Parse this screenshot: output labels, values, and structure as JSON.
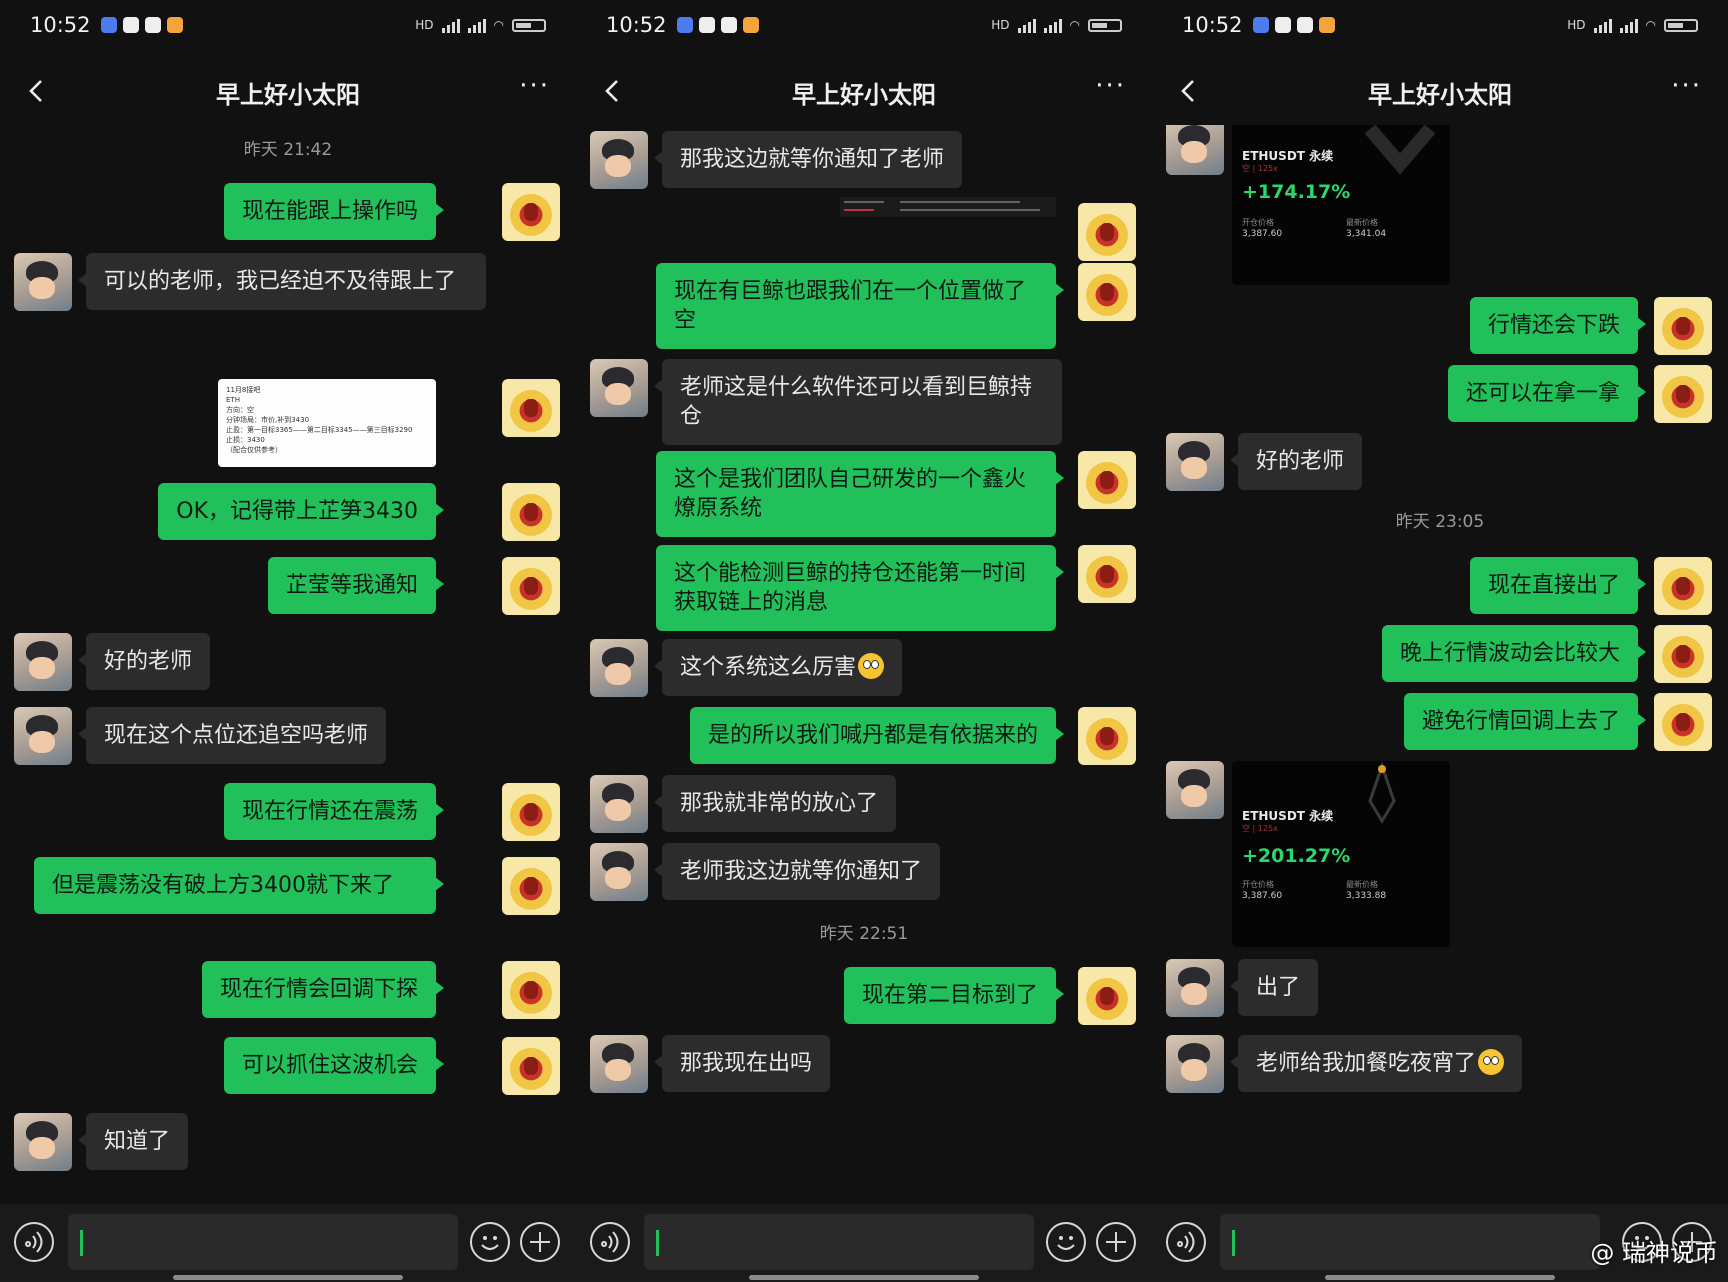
{
  "status_bar": {
    "time": "10:52",
    "network": "5G 4G",
    "hd": "HD"
  },
  "chat": {
    "title": "早上好小太阳"
  },
  "screens": [
    {
      "time_labels": [
        "昨天 21:42"
      ],
      "messages": [
        {
          "from": "me",
          "text": "现在能跟上操作吗"
        },
        {
          "from": "other",
          "text": "可以的老师，我已经迫不及待跟上了"
        },
        {
          "from": "me",
          "type": "image",
          "image_text": [
            "11月8接吧",
            "ETH",
            "方向：空",
            "分钟场局：市价,补到3430",
            "止盈：第一目标3365——第二目标3345——第三目标3290",
            "止损：3430",
            "（配合仅供参考）"
          ]
        },
        {
          "from": "me",
          "text": "OK，记得带上芷笋3430"
        },
        {
          "from": "me",
          "text": "芷莹等我通知"
        },
        {
          "from": "other",
          "text": "好的老师"
        },
        {
          "from": "other",
          "text": "现在这个点位还追空吗老师"
        },
        {
          "from": "me",
          "text": "现在行情还在震荡"
        },
        {
          "from": "me",
          "text": "但是震荡没有破上方3400就下来了"
        },
        {
          "from": "me",
          "text": "现在行情会回调下探"
        },
        {
          "from": "me",
          "text": "可以抓住这波机会"
        },
        {
          "from": "other",
          "text": "知道了"
        }
      ]
    },
    {
      "time_labels": [
        "昨天 22:51"
      ],
      "messages": [
        {
          "from": "other",
          "text": "那我这边就等你通知了老师"
        },
        {
          "from": "me",
          "type": "image",
          "image_text": []
        },
        {
          "from": "me",
          "text": "现在有巨鲸也跟我们在一个位置做了空"
        },
        {
          "from": "other",
          "text": "老师这是什么软件还可以看到巨鲸持仓"
        },
        {
          "from": "me",
          "text": "这个是我们团队自己研发的一个鑫火燎原系统"
        },
        {
          "from": "me",
          "text": "这个能检测巨鲸的持仓还能第一时间获取链上的消息"
        },
        {
          "from": "other",
          "text": "这个系统这么厉害"
        },
        {
          "from": "me",
          "text": "是的所以我们喊丹都是有依据来的"
        },
        {
          "from": "other",
          "text": "那我就非常的放心了"
        },
        {
          "from": "other",
          "text": "老师我这边就等你通知了"
        },
        {
          "from": "me",
          "text": "现在第二目标到了"
        },
        {
          "from": "other",
          "text": "那我现在出吗"
        }
      ]
    },
    {
      "time_labels": [
        "昨天 23:05"
      ],
      "messages": [
        {
          "from": "me",
          "type": "card",
          "card": {
            "title": "ETHUSDT 永续",
            "sub": "空 | 125x",
            "pct": "+174.17%",
            "k1": "开仓价格",
            "v1": "3,387.60",
            "k2": "最新价格",
            "v2": "3,341.04"
          }
        },
        {
          "from": "me",
          "text": "行情还会下跌"
        },
        {
          "from": "me",
          "text": "还可以在拿一拿"
        },
        {
          "from": "other",
          "text": "好的老师"
        },
        {
          "from": "me",
          "text": "现在直接出了"
        },
        {
          "from": "me",
          "text": "晚上行情波动会比较大"
        },
        {
          "from": "me",
          "text": "避免行情回调上去了"
        },
        {
          "from": "other",
          "type": "card",
          "card": {
            "title": "ETHUSDT 永续",
            "sub": "空 | 125x",
            "pct": "+201.27%",
            "k1": "开仓价格",
            "v1": "3,387.60",
            "k2": "最新价格",
            "v2": "3,333.88"
          }
        },
        {
          "from": "other",
          "text": "出了"
        },
        {
          "from": "other",
          "text": "老师给我加餐吃夜宵了"
        }
      ]
    }
  ],
  "watermark": "@ 瑞神说币",
  "colors": {
    "bubble_me": "#22c05a",
    "bubble_other": "#2c2c2c",
    "background": "#111111",
    "profit": "#2bd66c"
  },
  "icons": [
    "back-arrow-icon",
    "more-dots-icon",
    "voice-icon",
    "emoji-icon",
    "plus-icon"
  ]
}
